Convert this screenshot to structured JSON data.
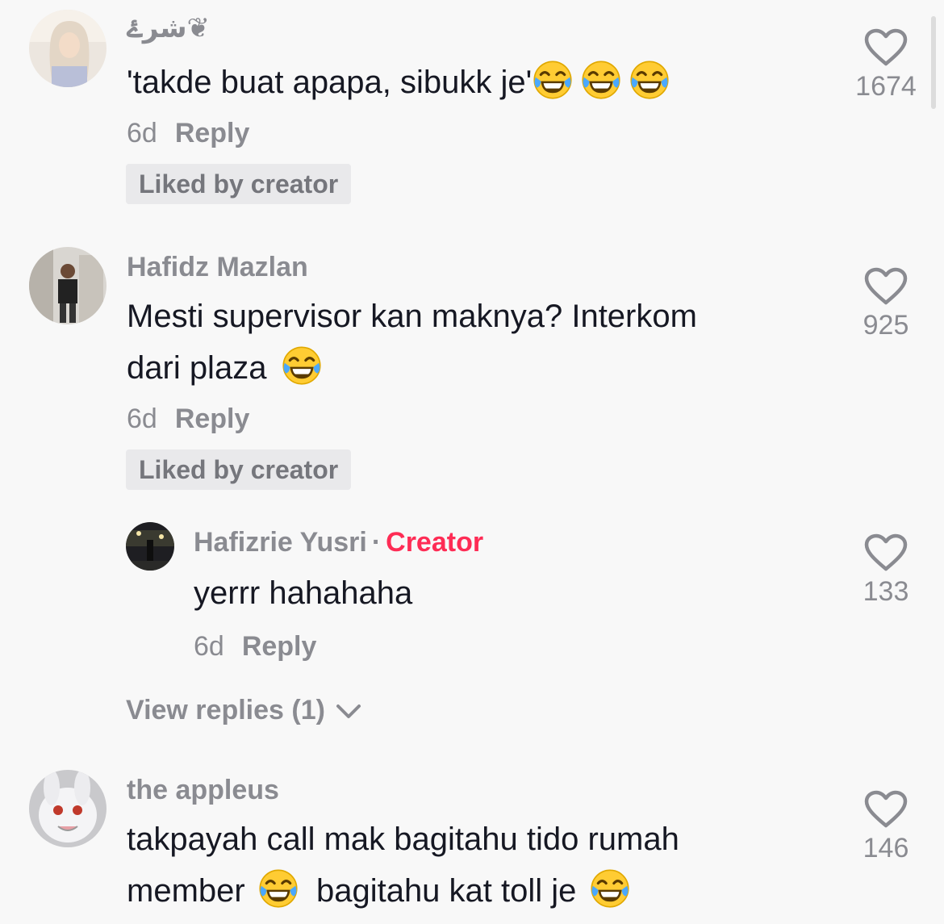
{
  "comments": [
    {
      "username": "شرۓ❦",
      "text": "'takde buat apapa, sibukk je'",
      "emoji_count": 3,
      "time": "6d",
      "reply_label": "Reply",
      "liked_badge": "Liked by creator",
      "likes": "1674"
    },
    {
      "username": "Hafidz Mazlan",
      "text_line1": "Mesti supervisor kan maknya? Interkom",
      "text_line2": "dari plaza",
      "time": "6d",
      "reply_label": "Reply",
      "liked_badge": "Liked by creator",
      "likes": "925",
      "reply": {
        "username": "Hafizrie Yusri",
        "separator": "·",
        "creator_label": "Creator",
        "text": "yerrr hahahaha",
        "time": "6d",
        "reply_label": "Reply",
        "likes": "133"
      },
      "view_replies": "View replies (1)"
    },
    {
      "username": "the appleus",
      "text_line1": "takpayah call mak bagitahu tido rumah",
      "text_line2a": "member",
      "text_line2b": "bagitahu kat toll je",
      "likes": "146"
    }
  ],
  "icons": {
    "like": "heart-outline-icon",
    "emoji": "face-with-tears-of-joy-icon",
    "expand": "chevron-down-icon"
  },
  "colors": {
    "creator": "#fe2c55",
    "muted": "#8a8b91",
    "text": "#161823",
    "background": "#f8f8f8"
  }
}
